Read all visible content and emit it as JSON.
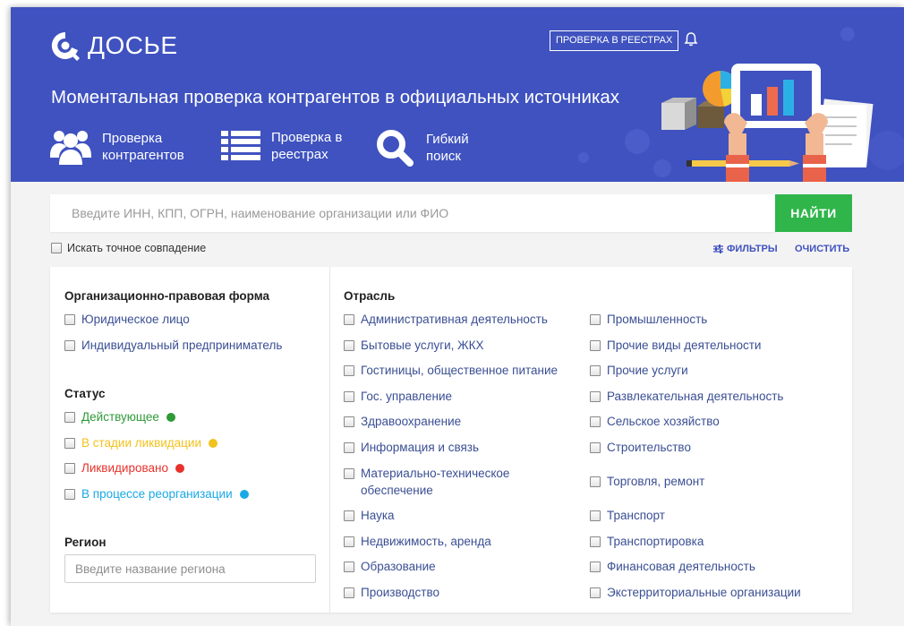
{
  "colors": {
    "brand": "#3f52bf",
    "button": "#2fb54a",
    "link": "#3a4f93"
  },
  "header": {
    "logo_text": "ДОСЬЕ",
    "registry_button": "ПРОВЕРКА В РЕЕСТРАХ",
    "tagline": "Моментальная проверка контрагентов в официальных источниках",
    "nav": [
      {
        "icon": "users-icon",
        "line1": "Проверка",
        "line2": "контрагентов"
      },
      {
        "icon": "list-icon",
        "line1": "Проверка в",
        "line2": "реестрах"
      },
      {
        "icon": "search-icon",
        "line1": "Гибкий",
        "line2": "поиск"
      }
    ]
  },
  "search": {
    "placeholder": "Введите ИНН, КПП, ОГРН, наименование организации или ФИО",
    "button": "НАЙТИ",
    "exact_match": "Искать точное совпадение",
    "filters": "ФИЛЬТРЫ",
    "clear": "ОЧИСТИТЬ"
  },
  "filters": {
    "legal_form": {
      "title": "Организационно-правовая форма",
      "options": [
        "Юридическое лицо",
        "Индивидуальный предприниматель"
      ]
    },
    "status": {
      "title": "Статус",
      "options": [
        {
          "label": "Действующее",
          "color": "#2e9a38"
        },
        {
          "label": "В стадии ликвидации",
          "color": "#f2c21d"
        },
        {
          "label": "Ликвидировано",
          "color": "#e8312b"
        },
        {
          "label": "В процессе реорганизации",
          "color": "#1aa9e6"
        }
      ]
    },
    "region": {
      "title": "Регион",
      "placeholder": "Введите название региона"
    },
    "industry": {
      "title": "Отрасль",
      "col1": [
        "Административная деятельность",
        "Бытовые услуги, ЖКХ",
        "Гостиницы, общественное питание",
        "Гос. управление",
        "Здравоохранение",
        "Информация и связь",
        "Материально-техническое",
        "обеспечение",
        "Наука",
        "Недвижимость, аренда",
        "Образование",
        "Производство"
      ],
      "col2": [
        "Промышленность",
        "Прочие виды деятельности",
        "Прочие услуги",
        "Развлекательная деятельность",
        "Сельское хозяйство",
        "Строительство",
        "Торговля, ремонт",
        "Транспорт",
        "Транспортировка",
        "Финансовая деятельность",
        "Экстерриториальные организации"
      ]
    }
  }
}
